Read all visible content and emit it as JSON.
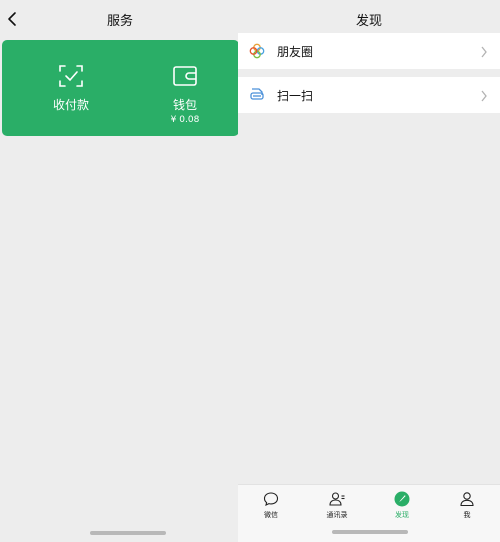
{
  "colors": {
    "accent": "#2aae67",
    "page_background": "#ededed",
    "row_background": "#ffffff"
  },
  "left_panel": {
    "title": "服务",
    "back_icon": "chevron-left-icon",
    "card": {
      "items": [
        {
          "label": "收付款",
          "icon": "scan-check-icon"
        },
        {
          "label": "钱包",
          "value": "¥ 0.08",
          "icon": "wallet-icon"
        }
      ]
    }
  },
  "right_panel": {
    "title": "发现",
    "menu": [
      {
        "label": "朋友圈",
        "icon": "moments-aperture-icon"
      },
      {
        "label": "扫一扫",
        "icon": "scan-icon"
      }
    ],
    "tabbar": [
      {
        "label": "微信",
        "icon": "chat-bubble-icon",
        "active": false
      },
      {
        "label": "通讯录",
        "icon": "contacts-icon",
        "active": false
      },
      {
        "label": "发现",
        "icon": "compass-icon",
        "active": true
      },
      {
        "label": "我",
        "icon": "person-icon",
        "active": false
      }
    ]
  }
}
